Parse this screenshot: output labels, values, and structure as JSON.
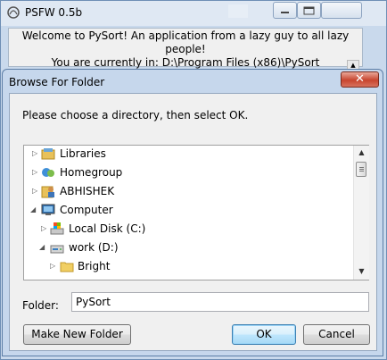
{
  "app": {
    "title": "PSFW 0.5b",
    "welcome_line": "Welcome to PySort! An application from a lazy guy to all lazy people!",
    "location_line": "You are currently in: D:\\Program Files (x86)\\PySort"
  },
  "dialog": {
    "title": "Browse For Folder",
    "close_glyph": "✕",
    "instruction": "Please choose a directory, then select OK.",
    "tree": [
      {
        "label": "Libraries",
        "icon": "libraries-icon",
        "expander": "▷"
      },
      {
        "label": "Homegroup",
        "icon": "homegroup-icon",
        "expander": "▷"
      },
      {
        "label": "ABHISHEK",
        "icon": "user-folder-icon",
        "expander": "▷"
      },
      {
        "label": "Computer",
        "icon": "computer-icon",
        "expander": "◢"
      },
      {
        "label": "Local Disk (C:)",
        "icon": "local-disk-icon",
        "expander": "▷"
      },
      {
        "label": "work (D:)",
        "icon": "drive-icon",
        "expander": "◢"
      },
      {
        "label": "Bright",
        "icon": "folder-icon",
        "expander": "▷"
      }
    ],
    "folder_label": "Folder:",
    "folder_value": "PySort",
    "buttons": {
      "make_new_folder": "Make New Folder",
      "ok": "OK",
      "cancel": "Cancel"
    }
  },
  "colors": {
    "window_frame": "#c9d9ec",
    "dialog_close": "#c8452f",
    "ok_border": "#3c7fb1"
  }
}
